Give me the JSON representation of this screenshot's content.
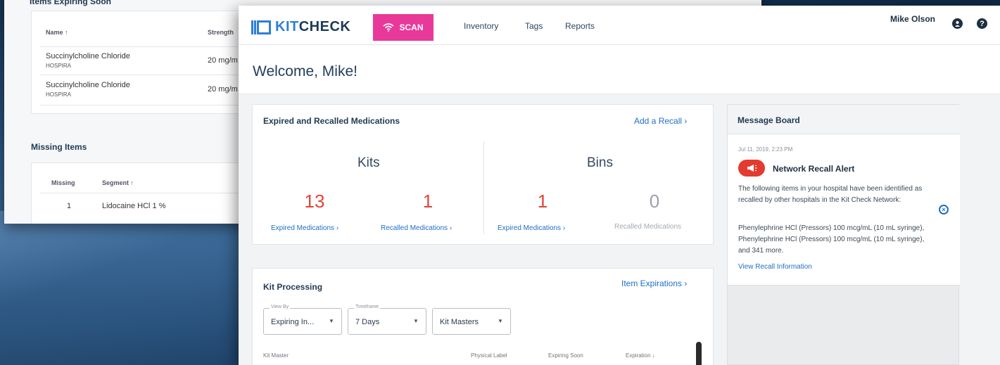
{
  "back_window": {
    "expiring_title": "Items Expiring Soon",
    "expiring_headers": {
      "name": "Name ↑",
      "strength": "Strength"
    },
    "expiring_rows": [
      {
        "name": "Succinylcholine Chloride",
        "maker": "HOSPIRA",
        "strength": "20 mg/m"
      },
      {
        "name": "Succinylcholine Chloride",
        "maker": "HOSPIRA",
        "strength": "20 mg/m"
      }
    ],
    "missing_title": "Missing Items",
    "missing_headers": {
      "missing": "Missing",
      "segment": "Segment ↑"
    },
    "missing_rows": [
      {
        "missing": "1",
        "segment": "Lidocaine HCl 1 %"
      }
    ]
  },
  "header": {
    "logo_prefix": "KIT",
    "logo_suffix": "CHECK",
    "scan_label": "SCAN",
    "nav": [
      "Inventory",
      "Tags",
      "Reports"
    ],
    "user_name": "Mike Olson",
    "user_icon": "user-icon",
    "help_icon": "help-icon"
  },
  "welcome": "Welcome, Mike!",
  "expired_card": {
    "title": "Expired and Recalled Medications",
    "link": "Add a Recall ›",
    "kits": {
      "label": "Kits",
      "expired_count": "13",
      "recalled_count": "1",
      "expired_link": "Expired Medications ›",
      "recalled_link": "Recalled Medications ›"
    },
    "bins": {
      "label": "Bins",
      "expired_count": "1",
      "recalled_count": "0",
      "expired_link": "Expired Medications ›",
      "recalled_label": "Recalled Medications"
    }
  },
  "kit_processing": {
    "title": "Kit Processing",
    "link": "Item Expirations ›",
    "filters": [
      {
        "legend": "View By",
        "value": "Expiring In..."
      },
      {
        "legend": "Timeframe",
        "value": "7 Days"
      },
      {
        "legend": "",
        "value": "Kit Masters"
      }
    ],
    "columns": [
      "Kit Master",
      "Physical Label",
      "Expiring Soon",
      "Expiration ↓"
    ]
  },
  "message_board": {
    "title": "Message Board",
    "date": "Jul 11, 2019, 2:23 PM",
    "alert_title": "Network Recall Alert",
    "text1": "The following items in your hospital have been identified as recalled by other hospitals in the Kit Check Network:",
    "text2": "Phenylephrine HCl (Pressors) 100 mcg/mL (10 mL syringe), Phenylephrine HCl (Pressors) 100 mcg/mL (10 mL syringe), and 341 more.",
    "link": "View Recall Information"
  },
  "colors": {
    "accent_blue": "#2f7fd8",
    "scan_pink": "#e8399a",
    "alert_red": "#e0453a",
    "link_blue": "#1f6fc4"
  }
}
